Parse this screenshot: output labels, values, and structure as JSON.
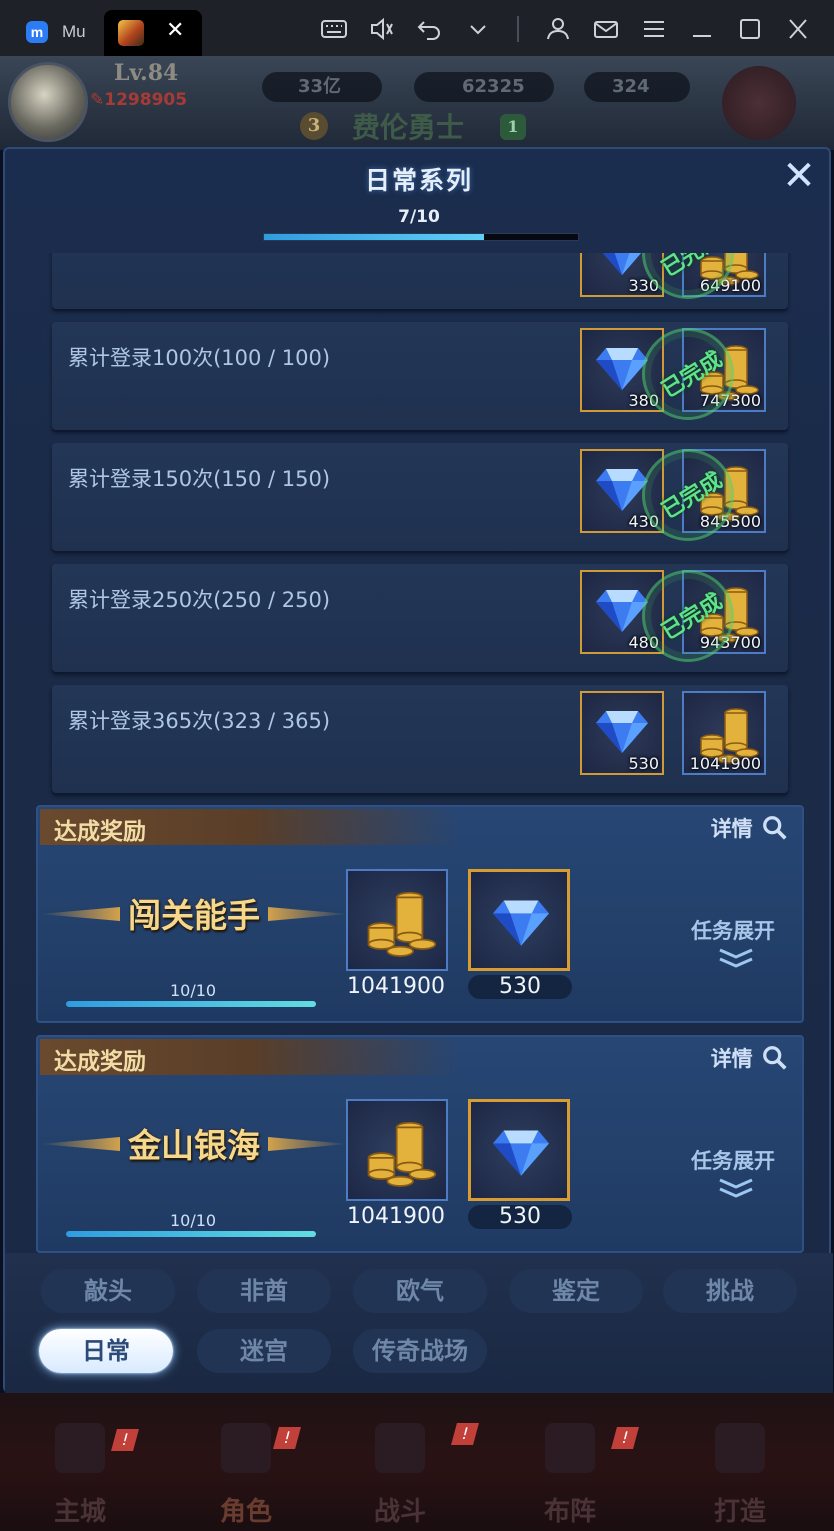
{
  "browser": {
    "tab_inactive_label": "Mu",
    "tab_close_glyph": "✕",
    "icons": [
      "keyboard-icon",
      "volume-icon",
      "undo-icon",
      "chevron-down-icon",
      "user-icon",
      "mail-icon",
      "menu-icon",
      "minimize-icon",
      "maximize-icon",
      "close-icon"
    ]
  },
  "hud": {
    "level": "Lv.84",
    "power": "1298905",
    "resources": [
      {
        "name": "gold",
        "value": "33亿"
      },
      {
        "name": "diamond",
        "value": "62325"
      },
      {
        "name": "ruby",
        "value": "324"
      }
    ],
    "rank_left": "3",
    "title": "费伦勇士",
    "rank_right": "1"
  },
  "modal": {
    "title": "日常系列",
    "close_glyph": "✕",
    "progress_text": "7/10",
    "progress": 0.7,
    "completed_stamp": "已完成",
    "tasks": [
      {
        "label": "",
        "gem": "330",
        "gold": "649100",
        "completed": true
      },
      {
        "label": "累计登录100次(100 / 100)",
        "gem": "380",
        "gold": "747300",
        "completed": true
      },
      {
        "label": "累计登录150次(150 / 150)",
        "gem": "430",
        "gold": "845500",
        "completed": true
      },
      {
        "label": "累计登录250次(250 / 250)",
        "gem": "480",
        "gold": "943700",
        "completed": true
      },
      {
        "label": "累计登录365次(323 / 365)",
        "gem": "530",
        "gold": "1041900",
        "completed": false
      }
    ],
    "achievements": [
      {
        "header": "达成奖励",
        "detail": "详情",
        "name": "闯关能手",
        "count": "10/10",
        "progress": 1.0,
        "gold": "1041900",
        "gem": "530",
        "expand": "任务展开"
      },
      {
        "header": "达成奖励",
        "detail": "详情",
        "name": "金山银海",
        "count": "10/10",
        "progress": 1.0,
        "gold": "1041900",
        "gem": "530",
        "expand": "任务展开"
      }
    ],
    "tabs_row1": [
      "敲头",
      "非酋",
      "欧气",
      "鉴定",
      "挑战"
    ],
    "tabs_row2": [
      "日常",
      "迷宫",
      "传奇战场"
    ],
    "active_tab": "日常"
  },
  "bottom_nav": [
    {
      "label": "主城",
      "alert": "!"
    },
    {
      "label": "角色",
      "alert": "!"
    },
    {
      "label": "战斗",
      "alert": "!"
    },
    {
      "label": "布阵",
      "alert": "!"
    },
    {
      "label": "打造",
      "alert": ""
    }
  ],
  "colors": {
    "accent_blue": "#2f9ce0",
    "gold_frame": "#d09a36",
    "stamp_green": "#5fe38a",
    "modal_bg": "#1b2d4e"
  }
}
